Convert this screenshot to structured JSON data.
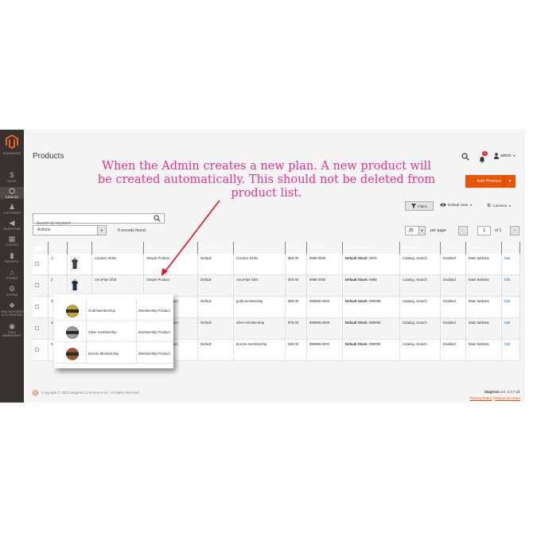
{
  "sidebar": {
    "items": [
      {
        "label": "DASHBOARD",
        "icon": "dashboard-icon",
        "glyph": "◔"
      },
      {
        "label": "SALES",
        "icon": "dollar-icon",
        "glyph": "$"
      },
      {
        "label": "CATALOG",
        "icon": "cube-icon",
        "glyph": "⬡"
      },
      {
        "label": "CUSTOMERS",
        "icon": "person-icon",
        "glyph": "♟"
      },
      {
        "label": "MARKETING",
        "icon": "megaphone-icon",
        "glyph": "◀"
      },
      {
        "label": "CONTENT",
        "icon": "layout-icon",
        "glyph": "▦"
      },
      {
        "label": "REPORTS",
        "icon": "bar-chart-icon",
        "glyph": "▮"
      },
      {
        "label": "STORES",
        "icon": "store-icon",
        "glyph": "⌂"
      },
      {
        "label": "SYSTEM",
        "icon": "gear-icon",
        "glyph": "⚙"
      },
      {
        "label": "FIND PARTNERS & EXTENSIONS",
        "icon": "blocks-icon",
        "glyph": "❖"
      },
      {
        "label": "RISHI MEMBERSHIP",
        "icon": "membership-icon",
        "glyph": "◉"
      }
    ],
    "active_index": 2
  },
  "header": {
    "title": "Products",
    "notification_count": "5",
    "user": "admin",
    "add_button": "Add Product"
  },
  "toolbar": {
    "filters": "Filters",
    "default_view": "Default View",
    "columns": "Columns",
    "search_placeholder": "Search by keyword",
    "actions": "Actions",
    "records": "5 records found",
    "per_page_value": "20",
    "per_page_label": "per page",
    "page": "1",
    "of_pages": "of 1"
  },
  "grid": {
    "columns": [
      "",
      "ID",
      "Thumbnail",
      "Name",
      "Type",
      "Attribute Set",
      "SKU",
      "Price",
      "Quantity",
      "Salable Quantity",
      "Visibility",
      "Status",
      "Websites",
      "Action"
    ],
    "rows": [
      {
        "id": "1",
        "name": "Counter Strike",
        "type": "Simple Product",
        "attr": "Default",
        "sku": "Counter Strike",
        "price": "$59.00",
        "qty": "9999.0000",
        "salable_label": "Default Stock:",
        "salable_value": "5978",
        "visibility": "Catalog, Search",
        "status": "Enabled",
        "websites": "Main Website",
        "action": "Edit"
      },
      {
        "id": "2",
        "name": "AeroFlan Shirt",
        "type": "Simple Product",
        "attr": "Default",
        "sku": "AeroFlan-Shirt",
        "price": "$79.00",
        "qty": "9999.0000",
        "salable_label": "Default Stock:",
        "salable_value": "9998",
        "visibility": "Catalog, Search",
        "status": "Enabled",
        "websites": "Main Website",
        "action": "Edit"
      },
      {
        "id": "3",
        "name": "Gold Membership",
        "type": "Membership Product",
        "attr": "Default",
        "sku": "gold-membership",
        "price": "$99.00",
        "qty": "999999.0000",
        "salable_label": "Default Stock:",
        "salable_value": "999998",
        "visibility": "Catalog, Search",
        "status": "Enabled",
        "websites": "Main Website",
        "action": "Edit"
      },
      {
        "id": "4",
        "name": "Silver membership",
        "type": "Membership Product",
        "attr": "Default",
        "sku": "silver-membership",
        "price": "$79.00",
        "qty": "999999.0000",
        "salable_label": "Default Stock:",
        "salable_value": "999999",
        "visibility": "Catalog, Search",
        "status": "Enabled",
        "websites": "Main Website",
        "action": "Edit"
      },
      {
        "id": "5",
        "name": "Bronze Membership",
        "type": "Membership Product",
        "attr": "Default",
        "sku": "bronze-membership",
        "price": "$49.00",
        "qty": "999999.0000",
        "salable_label": "Default Stock:",
        "salable_value": "999999",
        "visibility": "Catalog, Search",
        "status": "Enabled",
        "websites": "Main Website",
        "action": "Edit"
      }
    ]
  },
  "overlay": {
    "rows": [
      {
        "name": "Gold Membership",
        "type": "Membership Product",
        "badge": "GOLD",
        "color": "#c9a227"
      },
      {
        "name": "Silver membership",
        "type": "Membership Product",
        "badge": "SILVER",
        "color": "#9a9a9a"
      },
      {
        "name": "Bronze Membership",
        "type": "Membership Product",
        "badge": "BRONZE",
        "color": "#a0522d"
      }
    ]
  },
  "annotation": {
    "text": "When the Admin creates a new plan. A new product will be created automatically. This should not be deleted from product list.",
    "color": "#e82f8f"
  },
  "footer": {
    "copyright": "Copyright © 2022 Magento Commerce Inc. All rights reserved.",
    "version_label": "Magento",
    "version": "ver. 2.3.7-p2",
    "privacy": "Privacy Policy",
    "separator": "|",
    "report": "Report an Issue"
  },
  "colors": {
    "accent": "#eb5202",
    "sidebar": "#373330",
    "grid_header": "#514943",
    "link": "#007bdb"
  }
}
